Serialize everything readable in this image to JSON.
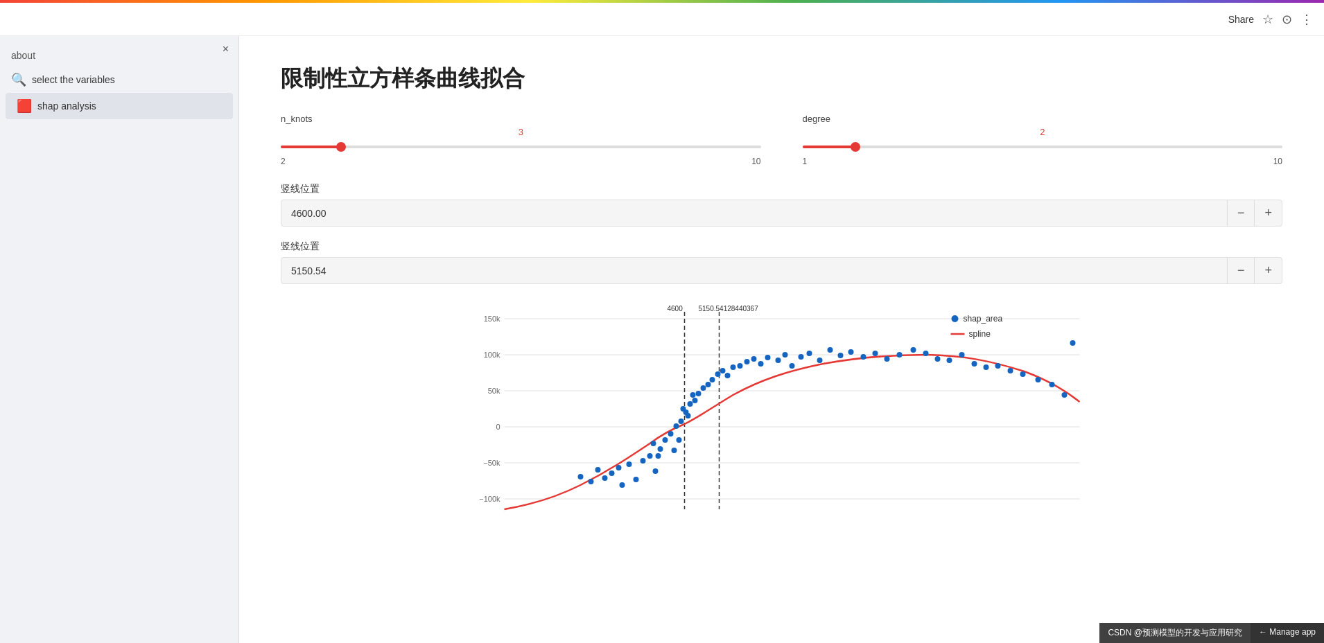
{
  "topbar": {},
  "header": {
    "share_label": "Share",
    "star_icon": "☆",
    "github_icon": "⊙",
    "more_icon": "⋮"
  },
  "sidebar": {
    "close_icon": "×",
    "about_label": "about",
    "select_variables_label": "select the variables",
    "select_variables_icon": "🔍",
    "shap_analysis_label": "shap analysis",
    "shap_analysis_icon": "🟥"
  },
  "main": {
    "title": "限制性立方样条曲线拟合",
    "n_knots": {
      "label": "n_knots",
      "value": 3,
      "min": 2,
      "max": 10,
      "fill_percent": 12.5
    },
    "degree": {
      "label": "degree",
      "value": 2,
      "min": 1,
      "max": 10,
      "fill_percent": 11.1
    },
    "vline1": {
      "label": "竖线位置",
      "value": "4600.00"
    },
    "vline2": {
      "label": "竖线位置",
      "value": "5150.54"
    }
  },
  "chart": {
    "x_min": 0,
    "x_max": 1200,
    "y_min": -100000,
    "y_max": 150000,
    "y_labels": [
      "150k",
      "100k",
      "50k",
      "0",
      "-50k",
      "-100k"
    ],
    "vline1_label": "4600",
    "vline2_label": "5150.54128440367",
    "legend": {
      "dot_label": "shap_area",
      "line_label": "spline"
    }
  },
  "footer": {
    "csdn_label": "CSDN @预测模型的开发与应用研究",
    "manage_label": "← Manage app"
  }
}
